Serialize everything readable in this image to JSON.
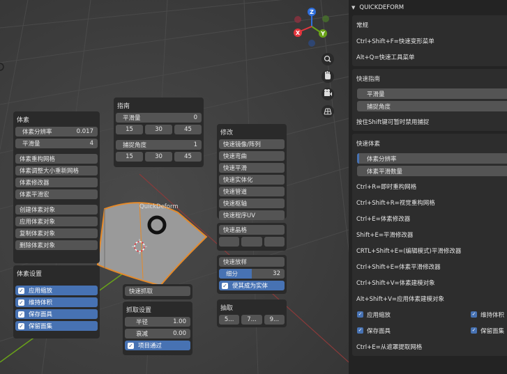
{
  "viewport": {
    "object_label": "QuickDeform",
    "axes": {
      "x": "X",
      "y": "Y",
      "z": "Z"
    },
    "nav_icons": [
      "zoom-icon",
      "hand-icon",
      "camera-icon",
      "grid-icon"
    ],
    "colors": {
      "x_axis": "#e5363e",
      "y_axis": "#6aa319",
      "z_axis": "#2f6fdd",
      "selection": "#e58a2a",
      "check": "#4772b3"
    }
  },
  "voxel_panel": {
    "title": "体素",
    "resolution_label": "体素分辨率",
    "resolution_value": "0.017",
    "smooth_label": "平滑量",
    "smooth_value": "4",
    "buttons1": [
      "体素重构网格",
      "体素调整大小重新网格",
      "体素修改器",
      "体素平滑宏"
    ],
    "buttons2": [
      "创建体素对象",
      "应用体素对象",
      "复制体素对象",
      "删除体素对象"
    ],
    "settings_title": "体素设置",
    "checks": [
      "应用缩放",
      "维持体积",
      "保存面具",
      "保留面集"
    ]
  },
  "guide_panel": {
    "title": "指南",
    "smooth_label": "平滑量",
    "smooth_value": "0",
    "row1": [
      "15",
      "30",
      "45"
    ],
    "snap_label": "捕捉角度",
    "snap_value": "1",
    "row2": [
      "15",
      "30",
      "45"
    ]
  },
  "grab_panel": {
    "quick_grab": "快速抓取",
    "title": "抓取设置",
    "radius_label": "半径",
    "radius_value": "1.00",
    "falloff_label": "衰减",
    "falloff_value": "0.00",
    "check_label": "项目通过"
  },
  "modify_panel": {
    "title": "修改",
    "buttons": [
      "快速镜像/阵列",
      "快速弯曲",
      "快速平滑",
      "快速实体化",
      "快速管道",
      "快速枢轴",
      "快速程序UV"
    ],
    "lattice": "快速晶格",
    "lattice_cells": [
      "",
      "",
      ""
    ],
    "tension": "快速放样",
    "subdiv_label": "细分",
    "subdiv_value": "32",
    "solid_check": "使其成为实体"
  },
  "extract_panel": {
    "title": "抽取",
    "buttons": [
      "5...",
      "7...",
      "9..."
    ]
  },
  "sidebar": {
    "header": "QUICKDEFORM",
    "general_title": "常规",
    "general_lines": [
      "Ctrl+Shift+F=快速变形菜单",
      "Alt+Q=快速工具菜单"
    ],
    "guide_title": "快速指南",
    "guide_buttons": [
      "平滑量",
      "捕捉角度"
    ],
    "guide_note": "按住Shift键可暂时禁用捕捉",
    "voxel_title": "快速体素",
    "voxel_slider": "体素分辨率",
    "voxel_button": "体素平滑数量",
    "voxel_lines": [
      "Ctrl+R=即时重构网格",
      "Ctrl+Shift+R=视觉重构网格",
      "Ctrl+E=体素修改器",
      "Shift+E=平滑修改器",
      "CRTL+Shift+E=(编辑模式)平滑修改器",
      "Ctrl+Shift+E=体素平滑修改器",
      "Ctrl+Shift+V=体素建模对象",
      "Alt+Shift+V=应用体素建模对象"
    ],
    "checks": [
      "应用缩放",
      "维持体积",
      "保存面具",
      "保留面集"
    ],
    "last_line": "Ctrl+E=从遮罩提取网格"
  }
}
